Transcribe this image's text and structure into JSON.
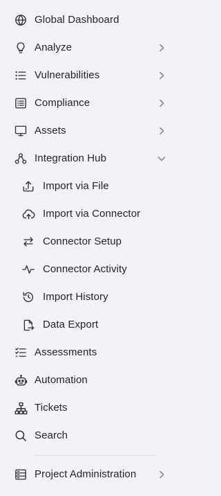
{
  "nav": {
    "global_dashboard": "Global Dashboard",
    "analyze": "Analyze",
    "vulnerabilities": "Vulnerabilities",
    "compliance": "Compliance",
    "assets": "Assets",
    "integration_hub": "Integration Hub",
    "integration_sub": {
      "import_file": "Import via File",
      "import_connector": "Import via Connector",
      "connector_setup": "Connector Setup",
      "connector_activity": "Connector Activity",
      "import_history": "Import History",
      "data_export": "Data Export"
    },
    "assessments": "Assessments",
    "automation": "Automation",
    "tickets": "Tickets",
    "search": "Search",
    "project_administration": "Project Administration"
  },
  "icons": {
    "global_dashboard": "globe-icon",
    "analyze": "lightbulb-icon",
    "vulnerabilities": "list-icon",
    "compliance": "checklist-icon",
    "assets": "monitor-icon",
    "integration_hub": "hub-icon",
    "import_file": "upload-tray-icon",
    "import_connector": "cloud-upload-icon",
    "connector_setup": "swap-arrows-icon",
    "connector_activity": "activity-icon",
    "import_history": "history-icon",
    "data_export": "file-export-icon",
    "assessments": "task-list-icon",
    "automation": "robot-icon",
    "tickets": "sitemap-icon",
    "search": "search-icon",
    "project_administration": "server-icon"
  },
  "colors": {
    "background": "#f3f2f7",
    "text": "#1f2328",
    "icon": "#2b2f36",
    "chevron": "#8a8d94",
    "divider": "#dcdbe2"
  }
}
